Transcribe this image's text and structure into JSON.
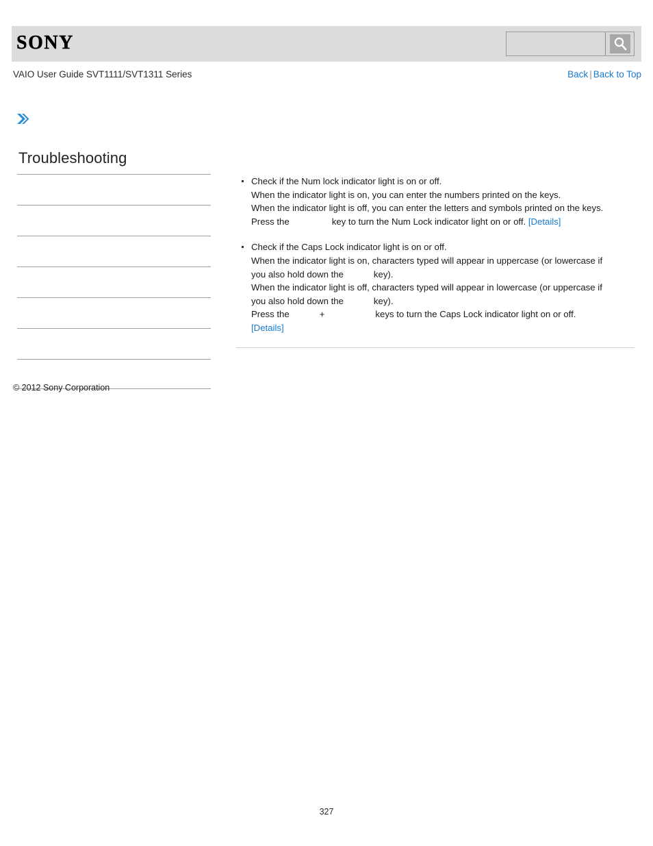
{
  "header": {
    "logo_text": "SONY",
    "search": {
      "value": "",
      "placeholder": "",
      "button_icon": "search-icon"
    }
  },
  "subheader": {
    "guide_title": "VAIO User Guide SVT1111/SVT1311 Series",
    "back_label": "Back",
    "separator": "|",
    "back_to_top_label": "Back to Top"
  },
  "breadcrumb": {
    "icon": "double-chevron-right-icon",
    "text": ""
  },
  "sidebar": {
    "title": "Troubleshooting",
    "items": [
      {
        "label": ""
      },
      {
        "label": ""
      },
      {
        "label": ""
      },
      {
        "label": ""
      },
      {
        "label": ""
      },
      {
        "label": ""
      },
      {
        "label": ""
      }
    ]
  },
  "content": {
    "bullets": [
      {
        "lines": [
          "Check if the Num lock indicator light is on or off.",
          "When the indicator light is on, you can enter the numbers printed on the keys.",
          "When the indicator light is off, you can enter the letters and symbols printed on the keys."
        ],
        "press_prefix": "Press the",
        "press_suffix": "key to turn the Num Lock indicator light on or off.",
        "details_label": "[Details]"
      },
      {
        "lines": [
          "Check if the Caps Lock indicator light is on or off.",
          "When the indicator light is on, characters typed will appear in uppercase (or lowercase if",
          "you also hold down the",
          "key).",
          "When the indicator light is off, characters typed will appear in lowercase (or uppercase if",
          "you also hold down the",
          "key)."
        ],
        "press_prefix": "Press the",
        "press_plus": "+",
        "press_suffix": "keys to turn the Caps Lock indicator light on or off.",
        "details_label": "[Details]"
      }
    ]
  },
  "footer": {
    "copyright": "© 2012 Sony Corporation",
    "page_number": "327"
  },
  "colors": {
    "link": "#1579d0",
    "header_band": "#dcdcdc",
    "rule": "#9e9e9e",
    "accent": "#2b8fd4"
  }
}
